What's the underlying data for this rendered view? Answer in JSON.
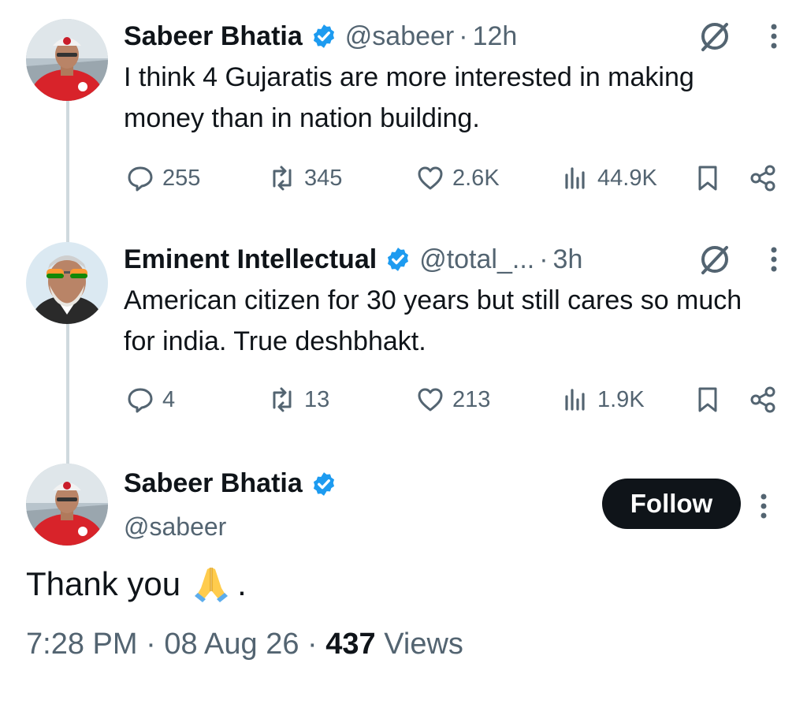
{
  "thread": [
    {
      "name": "Sabeer Bhatia",
      "handle": "@sabeer",
      "dot": "·",
      "time": "12h",
      "text": "I think 4 Gujaratis are more interested in making money than in nation building.",
      "replies": "255",
      "reposts": "345",
      "likes": "2.6K",
      "views": "44.9K"
    },
    {
      "name": "Eminent Intellectual",
      "handle": "@total_...",
      "dot": "·",
      "time": "3h",
      "text": "American citizen for 30 years but still cares so much for india. True deshbhakt.",
      "replies": "4",
      "reposts": "13",
      "likes": "213",
      "views": "1.9K"
    }
  ],
  "main": {
    "name": "Sabeer Bhatia",
    "handle": "@sabeer",
    "follow_label": "Follow",
    "text": "Thank you",
    "text_suffix": ".",
    "time": "7:28 PM",
    "sep1": "·",
    "date": "08 Aug 26",
    "sep2": "·",
    "views_count": "437",
    "views_label": "Views",
    "emoji": "folded-hands-emoji"
  },
  "icons": [
    "verified-badge-icon",
    "grok-icon",
    "more-icon",
    "reply-icon",
    "repost-icon",
    "like-icon",
    "views-icon",
    "bookmark-icon",
    "share-icon"
  ],
  "colors": {
    "verified": "#1d9bf0",
    "text": "#0f1419",
    "secondary": "#536471",
    "thread_line": "#cfd9de",
    "follow_bg": "#0f1419"
  }
}
